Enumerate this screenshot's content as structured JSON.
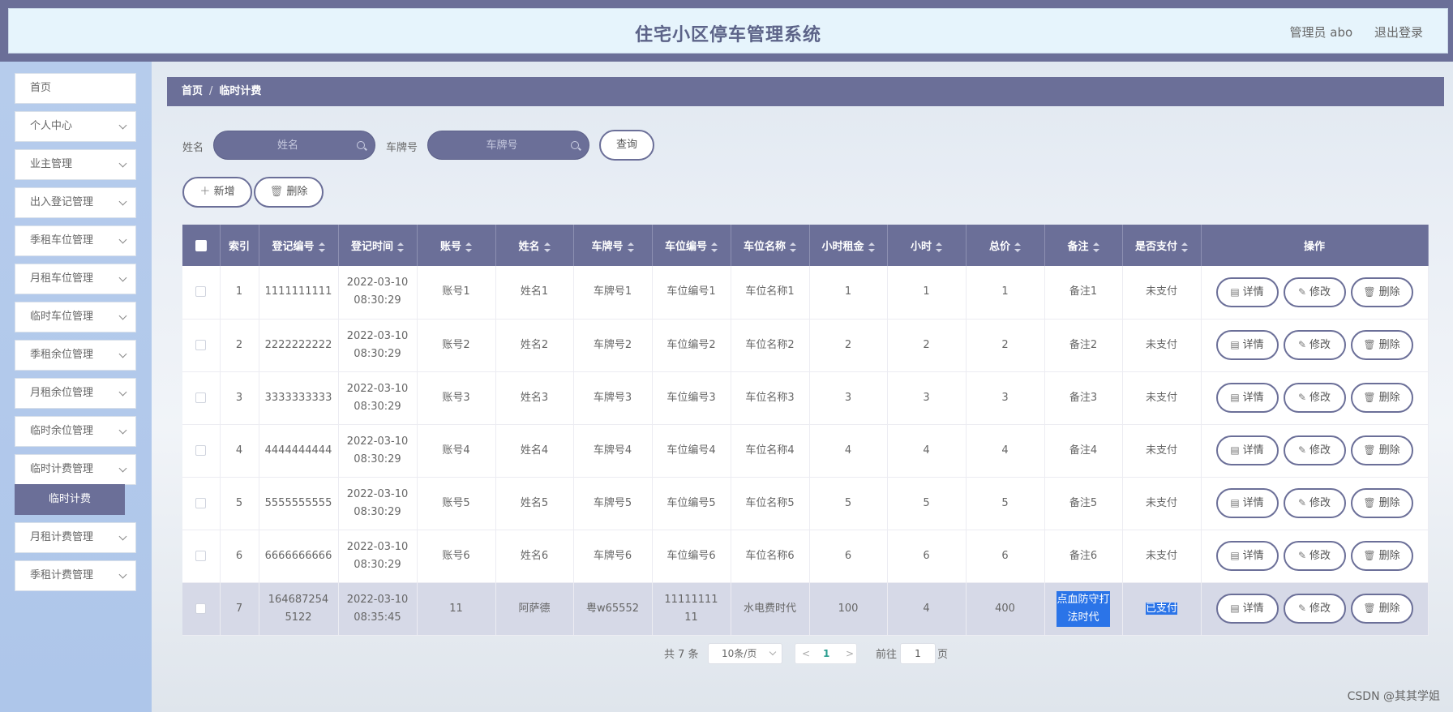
{
  "header": {
    "title": "住宅小区停车管理系统",
    "user": "管理员 abo",
    "logout": "退出登录"
  },
  "sidebar": {
    "items": [
      {
        "label": "首页",
        "expandable": false
      },
      {
        "label": "个人中心",
        "expandable": true
      },
      {
        "label": "业主管理",
        "expandable": true
      },
      {
        "label": "出入登记管理",
        "expandable": true
      },
      {
        "label": "季租车位管理",
        "expandable": true
      },
      {
        "label": "月租车位管理",
        "expandable": true
      },
      {
        "label": "临时车位管理",
        "expandable": true
      },
      {
        "label": "季租余位管理",
        "expandable": true
      },
      {
        "label": "月租余位管理",
        "expandable": true
      },
      {
        "label": "临时余位管理",
        "expandable": true
      },
      {
        "label": "临时计费管理",
        "expandable": true
      },
      {
        "label": "月租计费管理",
        "expandable": true
      },
      {
        "label": "季租计费管理",
        "expandable": true
      }
    ],
    "active_sub": "临时计费"
  },
  "breadcrumb": {
    "home": "首页",
    "sep": "/",
    "current": "临时计费"
  },
  "search": {
    "name_label": "姓名",
    "name_placeholder": "姓名",
    "plate_label": "车牌号",
    "plate_placeholder": "车牌号",
    "query_button": "查询"
  },
  "actions": {
    "add": "新增",
    "delete": "删除"
  },
  "table": {
    "headers": [
      "索引",
      "登记编号",
      "登记时间",
      "账号",
      "姓名",
      "车牌号",
      "车位编号",
      "车位名称",
      "小时租金",
      "小时",
      "总价",
      "备注",
      "是否支付",
      "操作"
    ],
    "rows": [
      [
        "1",
        "1111111111",
        "2022-03-10 08:30:29",
        "账号1",
        "姓名1",
        "车牌号1",
        "车位编号1",
        "车位名称1",
        "1",
        "1",
        "1",
        "备注1",
        "未支付"
      ],
      [
        "2",
        "2222222222",
        "2022-03-10 08:30:29",
        "账号2",
        "姓名2",
        "车牌号2",
        "车位编号2",
        "车位名称2",
        "2",
        "2",
        "2",
        "备注2",
        "未支付"
      ],
      [
        "3",
        "3333333333",
        "2022-03-10 08:30:29",
        "账号3",
        "姓名3",
        "车牌号3",
        "车位编号3",
        "车位名称3",
        "3",
        "3",
        "3",
        "备注3",
        "未支付"
      ],
      [
        "4",
        "4444444444",
        "2022-03-10 08:30:29",
        "账号4",
        "姓名4",
        "车牌号4",
        "车位编号4",
        "车位名称4",
        "4",
        "4",
        "4",
        "备注4",
        "未支付"
      ],
      [
        "5",
        "5555555555",
        "2022-03-10 08:30:29",
        "账号5",
        "姓名5",
        "车牌号5",
        "车位编号5",
        "车位名称5",
        "5",
        "5",
        "5",
        "备注5",
        "未支付"
      ],
      [
        "6",
        "6666666666",
        "2022-03-10 08:30:29",
        "账号6",
        "姓名6",
        "车牌号6",
        "车位编号6",
        "车位名称6",
        "6",
        "6",
        "6",
        "备注6",
        "未支付"
      ],
      [
        "7",
        "1646872545122",
        "2022-03-10 08:35:45",
        "11",
        "阿萨德",
        "粤w65552",
        "1111111111",
        "水电费时代",
        "100",
        "4",
        "400",
        "点血防守打法时代",
        "已支付"
      ]
    ],
    "row_actions": {
      "detail": "详情",
      "edit": "修改",
      "delete": "删除"
    },
    "highlight_row": 7
  },
  "pagination": {
    "total": "共 7 条",
    "page_size": "10条/页",
    "current_page": "1",
    "goto_label": "前往",
    "goto_value": "1",
    "page_suffix": "页"
  },
  "watermark": "CSDN @其其学姐",
  "colors": {
    "primary": "#6b6f98",
    "header_bg": "#e6f4fc",
    "sidebar_bg": "#b6ccec",
    "selection": "#2b74e8"
  }
}
